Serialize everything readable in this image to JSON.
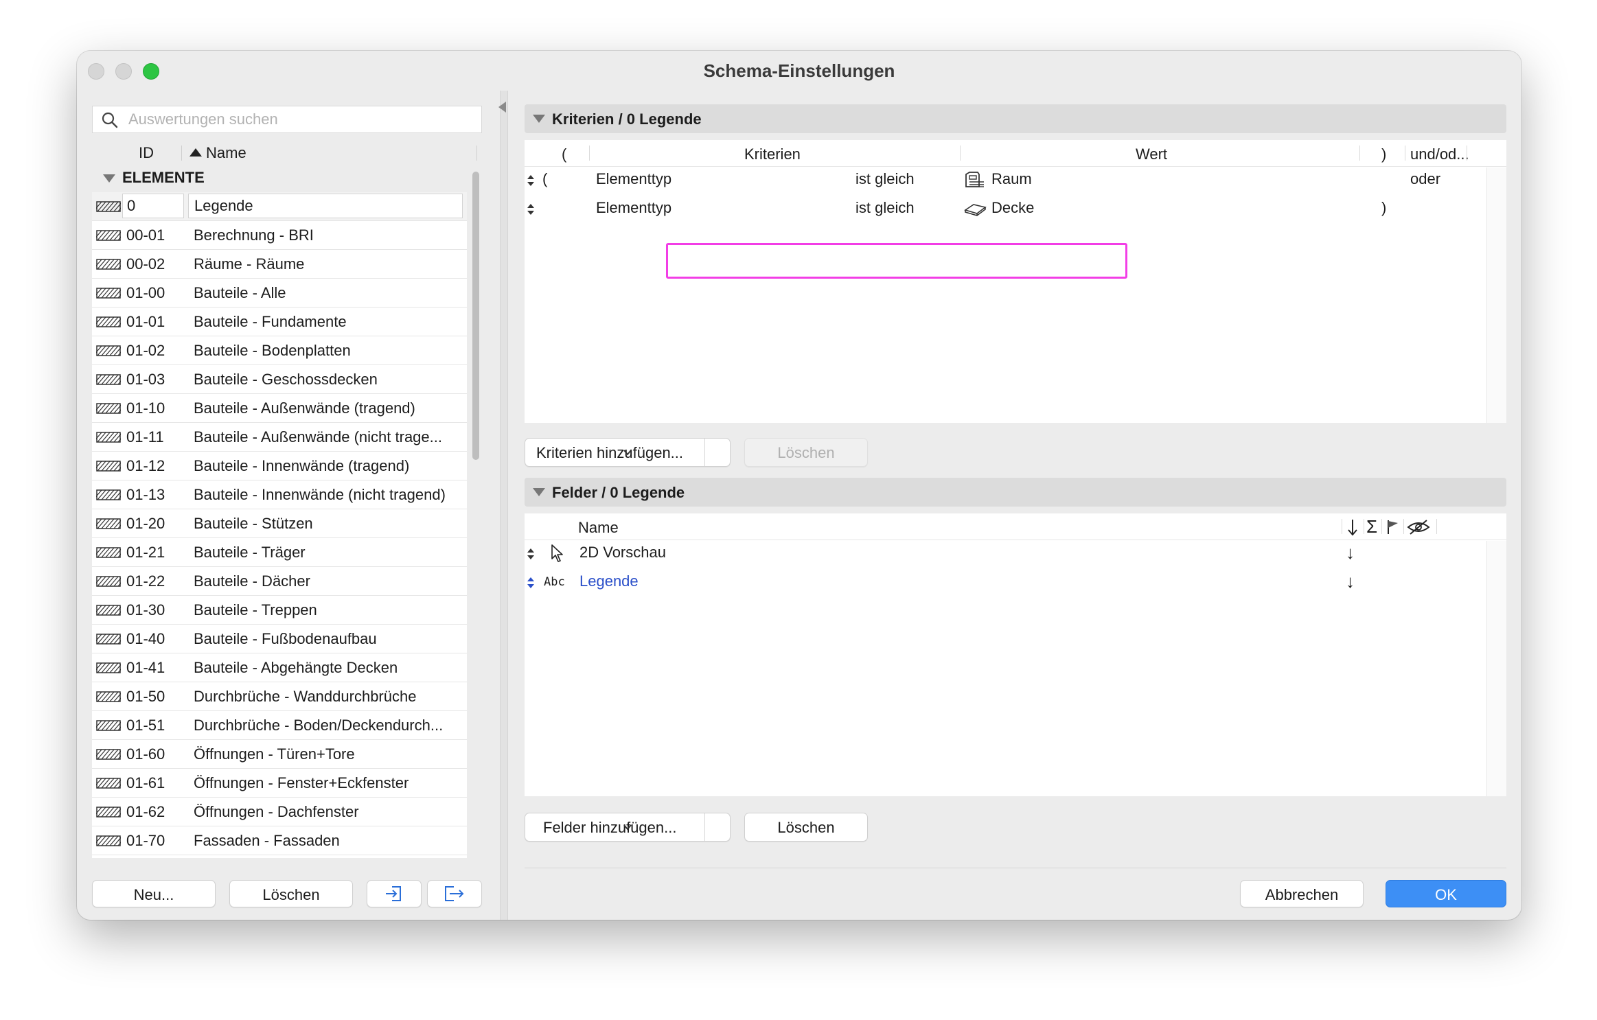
{
  "window": {
    "title": "Schema-Einstellungen"
  },
  "left": {
    "search_placeholder": "Auswertungen suchen",
    "col_id": "ID",
    "col_name": "Name",
    "group": "ELEMENTE",
    "rows": [
      {
        "id": "0",
        "name": "Legende"
      },
      {
        "id": "00-01",
        "name": "Berechnung - BRI"
      },
      {
        "id": "00-02",
        "name": "Räume - Räume"
      },
      {
        "id": "01-00",
        "name": "Bauteile - Alle"
      },
      {
        "id": "01-01",
        "name": "Bauteile - Fundamente"
      },
      {
        "id": "01-02",
        "name": "Bauteile - Bodenplatten"
      },
      {
        "id": "01-03",
        "name": "Bauteile - Geschossdecken"
      },
      {
        "id": "01-10",
        "name": "Bauteile - Außenwände (tragend)"
      },
      {
        "id": "01-11",
        "name": "Bauteile - Außenwände (nicht trage..."
      },
      {
        "id": "01-12",
        "name": "Bauteile - Innenwände (tragend)"
      },
      {
        "id": "01-13",
        "name": "Bauteile - Innenwände (nicht tragend)"
      },
      {
        "id": "01-20",
        "name": "Bauteile - Stützen"
      },
      {
        "id": "01-21",
        "name": "Bauteile - Träger"
      },
      {
        "id": "01-22",
        "name": "Bauteile - Dächer"
      },
      {
        "id": "01-30",
        "name": "Bauteile - Treppen"
      },
      {
        "id": "01-40",
        "name": "Bauteile - Fußbodenaufbau"
      },
      {
        "id": "01-41",
        "name": "Bauteile - Abgehängte Decken"
      },
      {
        "id": "01-50",
        "name": "Durchbrüche - Wanddurchbrüche"
      },
      {
        "id": "01-51",
        "name": "Durchbrüche - Boden/Deckendurch..."
      },
      {
        "id": "01-60",
        "name": "Öffnungen - Türen+Tore"
      },
      {
        "id": "01-61",
        "name": "Öffnungen - Fenster+Eckfenster"
      },
      {
        "id": "01-62",
        "name": "Öffnungen - Dachfenster"
      },
      {
        "id": "01-70",
        "name": "Fassaden - Fassaden"
      }
    ],
    "btn_new": "Neu...",
    "btn_delete": "Löschen"
  },
  "criteria": {
    "title": "Kriterien / 0 Legende",
    "head_open": "(",
    "head_criteria": "Kriterien",
    "head_value": "Wert",
    "head_close": ")",
    "head_andor": "und/od...",
    "rows": [
      {
        "open": "(",
        "field": "Elementtyp",
        "op": "ist gleich",
        "value": "Raum",
        "close": "",
        "andor": "oder"
      },
      {
        "open": "",
        "field": "Elementtyp",
        "op": "ist gleich",
        "value": "Decke",
        "close": ")",
        "andor": ""
      }
    ],
    "btn_add": "Kriterien hinzufügen...",
    "btn_delete": "Löschen"
  },
  "fields": {
    "title": "Felder / 0 Legende",
    "head_name": "Name",
    "rows": [
      {
        "type": "",
        "name": "2D Vorschau",
        "sort": "↓"
      },
      {
        "type": "Abc",
        "name": "Legende",
        "sort": "↓"
      }
    ],
    "btn_add": "Felder hinzufügen...",
    "btn_delete": "Löschen"
  },
  "footer": {
    "cancel": "Abbrechen",
    "ok": "OK"
  },
  "colors": {
    "accent": "#3d8ff5",
    "highlight": "#f23ee6",
    "link": "#2a4fc9"
  }
}
